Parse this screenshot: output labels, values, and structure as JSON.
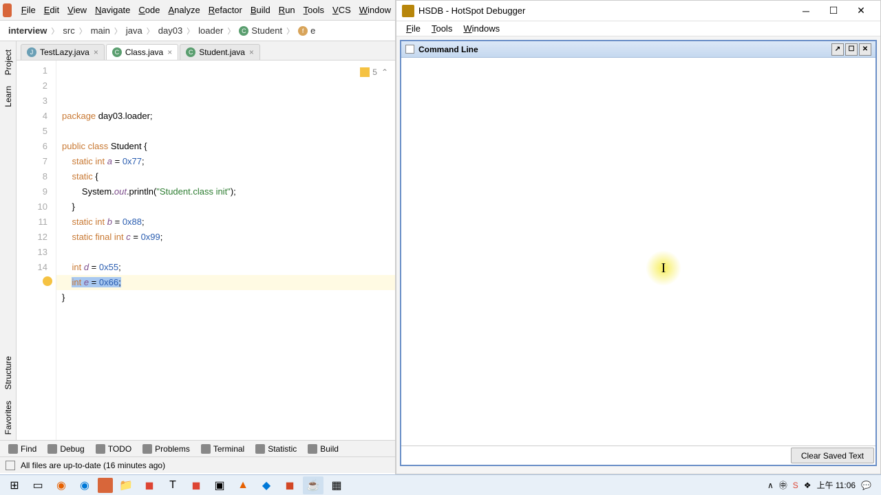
{
  "ide": {
    "menu": [
      "File",
      "Edit",
      "View",
      "Navigate",
      "Code",
      "Analyze",
      "Refactor",
      "Build",
      "Run",
      "Tools",
      "VCS",
      "Window"
    ],
    "breadcrumbs": [
      "interview",
      "src",
      "main",
      "java",
      "day03",
      "loader",
      "Student",
      "e"
    ],
    "tabs": [
      {
        "label": "TestLazy.java",
        "active": false,
        "icon": "java"
      },
      {
        "label": "Class.java",
        "active": true,
        "icon": "class"
      },
      {
        "label": "Student.java",
        "active": false,
        "icon": "class"
      }
    ],
    "side_tabs_top": [
      "Project",
      "Learn"
    ],
    "side_tabs_bottom": [
      "Structure",
      "Favorites"
    ],
    "inspection_count": "5",
    "code_lines": [
      {
        "n": 1,
        "html": "<span class='kw'>package</span> day03.loader;"
      },
      {
        "n": 2,
        "html": ""
      },
      {
        "n": 3,
        "html": "<span class='kw'>public class</span> Student {"
      },
      {
        "n": 4,
        "html": "    <span class='kw'>static int</span> <span class='fld'>a</span> = <span class='num'>0x77</span>;"
      },
      {
        "n": 5,
        "html": "    <span class='kw'>static</span> {"
      },
      {
        "n": 6,
        "html": "        System.<span class='fld'>out</span>.println(<span class='str'>\"Student.class init\"</span>);"
      },
      {
        "n": 7,
        "html": "    }"
      },
      {
        "n": 8,
        "html": "    <span class='kw'>static int</span> <span class='fld'>b</span> = <span class='num'>0x88</span>;"
      },
      {
        "n": 9,
        "html": "    <span class='kw'>static final int</span> <span class='fld'>c</span> = <span class='num'>0x99</span>;"
      },
      {
        "n": 10,
        "html": ""
      },
      {
        "n": 11,
        "html": "    <span class='kw'>int</span> <span class='fld'>d</span> = <span class='num'>0x55</span>;"
      },
      {
        "n": 12,
        "html": "    <span class='caret-line-sel'><span class='kw'>int</span> <span class='fld'>e</span> = <span class='num'>0x66</span>;</span>",
        "hl": true,
        "bulb": true
      },
      {
        "n": 13,
        "html": "}"
      },
      {
        "n": 14,
        "html": ""
      }
    ],
    "bottom_tabs": [
      "Find",
      "Debug",
      "TODO",
      "Problems",
      "Terminal",
      "Statistic",
      "Build"
    ],
    "status": "All files are up-to-date (16 minutes ago)"
  },
  "hsdb": {
    "title": "HSDB - HotSpot Debugger",
    "menu": [
      "File",
      "Tools",
      "Windows"
    ],
    "panel_title": "Command Line",
    "clear_btn": "Clear Saved Text"
  },
  "taskbar": {
    "time": "上午 11:06",
    "tray_chevron": "∧"
  }
}
